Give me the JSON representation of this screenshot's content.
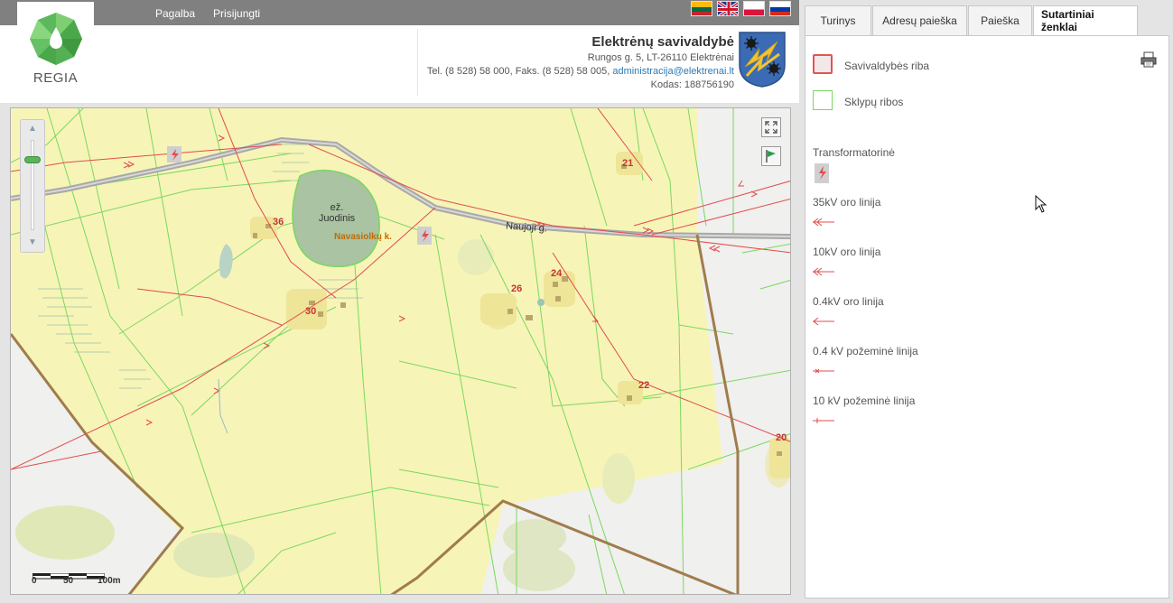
{
  "topnav": {
    "help": "Pagalba",
    "login": "Prisijungti"
  },
  "flags": [
    "lt",
    "gb",
    "pl",
    "ru"
  ],
  "logo": {
    "text": "REGIA"
  },
  "municipality": {
    "title": "Elektrėnų savivaldybė",
    "address": "Rungos g. 5, LT-26110 Elektrėnai",
    "phone": "Tel. (8 528) 58 000, Faks. (8 528) 58 005,",
    "email": "administracija@elektrenai.lt",
    "code": "Kodas: 188756190"
  },
  "map": {
    "lake_label_1": "ež.",
    "lake_label_2": "Juodinis",
    "village_label": "Navasiolkų k.",
    "road_label": "Naujoji g.",
    "house_numbers": [
      "21",
      "36",
      "30",
      "26",
      "24",
      "22",
      "20"
    ],
    "scale": {
      "l0": "0",
      "l50": "50",
      "l100": "100m"
    },
    "colors": {
      "land": "#f7f4b8",
      "parcel": "#7ad85e",
      "boundary": "#a07c4c",
      "power": "#e14c4c",
      "lake": "#a9c3a3",
      "road": "#a8a8a8"
    }
  },
  "tabs": [
    {
      "label": "Turinys",
      "active": false
    },
    {
      "label": "Adresų paieška",
      "active": false
    },
    {
      "label": "Paieška",
      "active": false
    },
    {
      "label": "Sutartiniai ženklai",
      "active": true
    }
  ],
  "legend": {
    "municipal_boundary": "Savivaldybės riba",
    "parcel_boundary": "Sklypų ribos",
    "transformer": "Transformatorinė",
    "line_35kv": "35kV oro linija",
    "line_10kv": "10kV oro linija",
    "line_04kv": "0.4kV oro linija",
    "line_04kv_underground": "0.4 kV požeminė linija",
    "line_10kv_underground": "10 kV požeminė linija"
  }
}
